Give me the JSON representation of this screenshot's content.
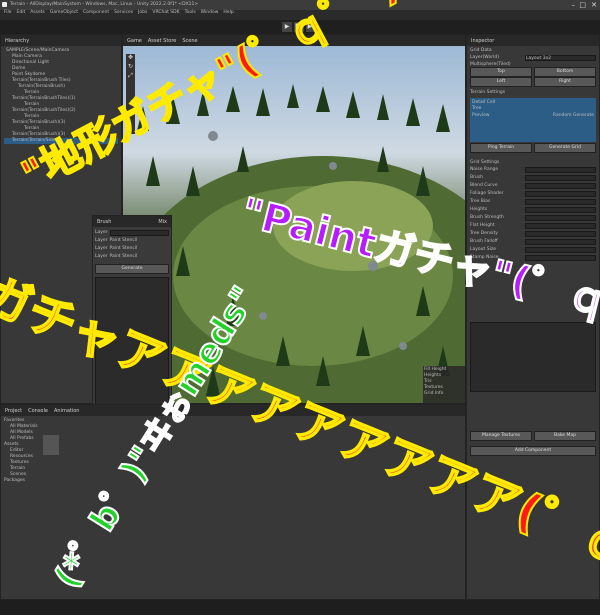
{
  "window": {
    "title": "Terrain - AllDisplay/MainSystem - Windows, Mac, Linux - Unity 2022.2.0f1* <DX11>",
    "menu": [
      "File",
      "Edit",
      "Assets",
      "GameObject",
      "Component",
      "Services",
      "Jobs",
      "VRChat SDK",
      "Tools",
      "Window",
      "Help"
    ]
  },
  "hierarchy": {
    "tab": "Hierarchy",
    "items": [
      "SAMPLE/Scene/MainCamera",
      "Main Camera",
      "Directional Light",
      "Dome",
      "Point Skydome",
      "Terrain(TerrainBrush Tiles)",
      "Terrain(TerrainBrush)",
      "Terrain",
      "Terrain(TerrainBrushTiles)(1)",
      "Terrain",
      "Terrain(TerrainBrushTiles)(2)",
      "Terrain",
      "Terrain(TerrainBrush)(3)",
      "Terrain",
      "Terrain(TerrainBrush)(3)",
      "Terrain(Terrain/Side)"
    ]
  },
  "scene_tabs": [
    "Game",
    "Asset Store",
    "Scene"
  ],
  "inspector": {
    "tab": "Inspector",
    "labels": [
      "Grid Data",
      "Layer(World)",
      "Multisphere(Tiled)",
      "Top",
      "Bottom",
      "Left",
      "Right",
      "Terrain Settings",
      "Detail Cell",
      "Tree",
      "Grid Settings",
      "Noise Range",
      "Brush",
      "Blend Curve",
      "Foliage Shader",
      "Tree Bias",
      "Heights",
      "Brush Strength",
      "Flat Height",
      "Tree Density",
      "Brush Falloff",
      "Layout Size",
      "Stamp Noise"
    ],
    "buttons": [
      "Ping Terrain",
      "Generate Grid",
      "Manage Textures",
      "Bake Map",
      "Add Component"
    ],
    "dropdown_value": "Layout 3x2",
    "mode_value": "Preview",
    "blend_value": "Random Generate"
  },
  "project": {
    "tabs": [
      "Project",
      "Console",
      "Animation"
    ],
    "folders": [
      "Favorites",
      "All Materials",
      "All Models",
      "All Prefabs",
      "Assets",
      "Editor",
      "Resources",
      "Textures",
      "Terrain",
      "Scenes",
      "Packages"
    ]
  },
  "overlay": {
    "title": "Brush",
    "lines": [
      "\"\"",
      "\"\"",
      "\"\"",
      "\"\""
    ],
    "fields": [
      "Layer",
      "Layer",
      "Layer",
      "Layer"
    ],
    "values": [
      "Paint Stencil",
      "Paint Stencil",
      "Paint Stencil"
    ],
    "button": "Generate",
    "status": "Mix"
  },
  "scene_info": {
    "lines": [
      "Fill Height",
      "Heights",
      "Tris",
      "Textures",
      "Grid Info"
    ]
  },
  "banner": {
    "line1": "\"地形ガチャ\"(゜ｑ゜*)",
    "line2": "\"Paintガチャ\"(゜ｑ゜",
    "line3": "ガチャアアアアアアアアア(゜ｑ゜*)",
    "line4": "(*゜b゜)\"ヰぉmeds\""
  },
  "colors": {
    "banner_red": "#ff1a1a",
    "banner_yellow": "#ffea00",
    "banner_purple": "#b61cff",
    "banner_green": "#22d12a"
  }
}
